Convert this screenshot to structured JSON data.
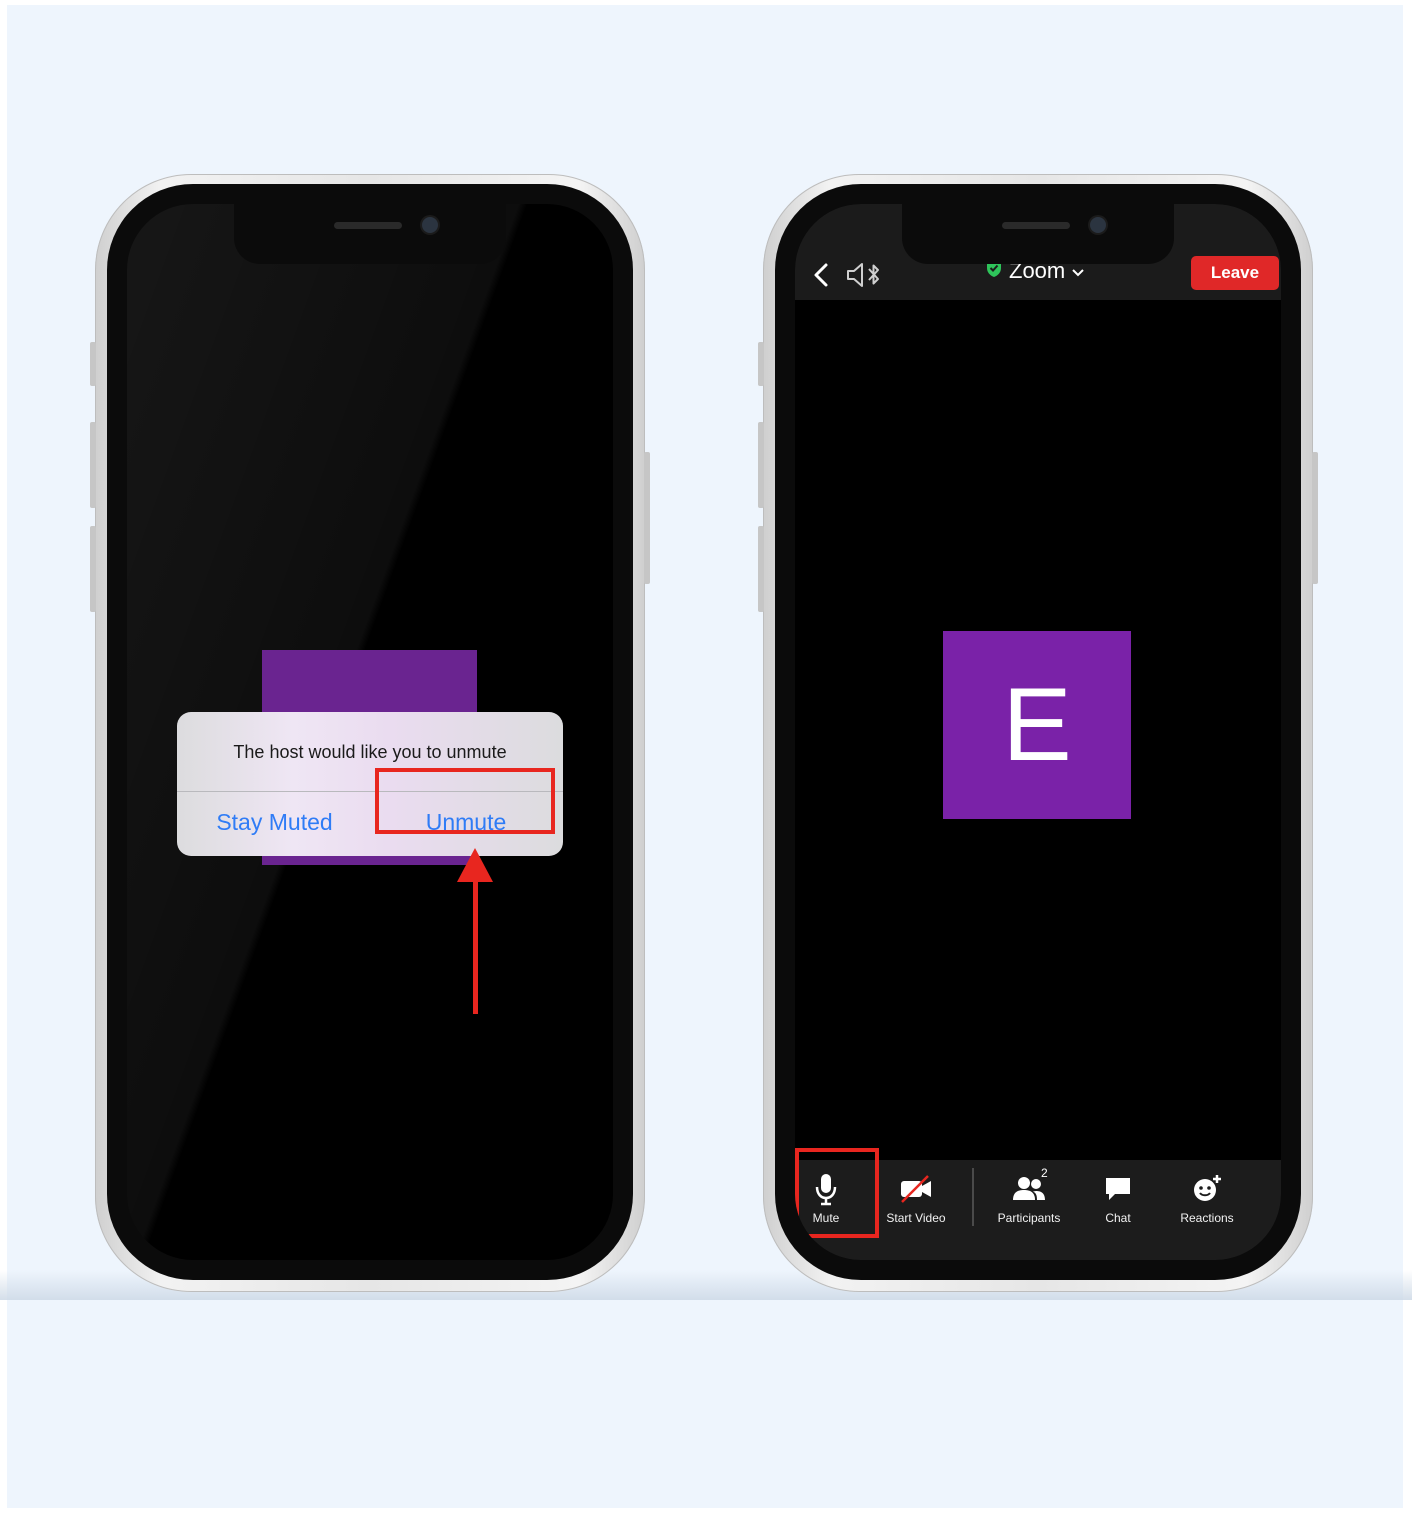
{
  "alert": {
    "message": "The host would like you to unmute",
    "stay_muted_label": "Stay Muted",
    "unmute_label": "Unmute"
  },
  "meeting": {
    "title": "Zoom",
    "leave_label": "Leave",
    "avatar_initial": "E",
    "participants_count": "2"
  },
  "toolbar": {
    "mute_label": "Mute",
    "start_video_label": "Start Video",
    "participants_label": "Participants",
    "chat_label": "Chat",
    "reactions_label": "Reactions"
  },
  "icons": {
    "back": "chevron-left-icon",
    "speaker": "speaker-bluetooth-icon",
    "shield": "shield-check-icon",
    "chevron": "chevron-down-icon",
    "microphone": "microphone-icon",
    "video_off": "video-off-icon",
    "participants": "participants-icon",
    "chat": "chat-bubble-icon",
    "reactions": "smiley-plus-icon"
  },
  "colors": {
    "accent_blue": "#2f7cf6",
    "leave_red": "#e02828",
    "highlight_red": "#e8261f",
    "avatar_purple": "#7a22a8",
    "secure_green": "#2ec45a"
  }
}
